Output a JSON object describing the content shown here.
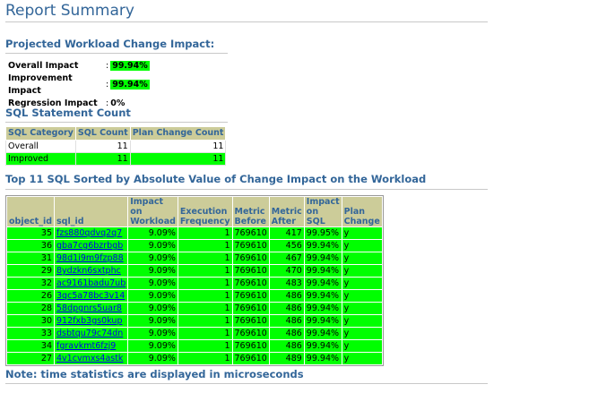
{
  "report": {
    "title": "Report Summary"
  },
  "impact": {
    "heading": "Projected Workload Change Impact:",
    "rows": [
      {
        "label": "Overall Impact",
        "sep": ":",
        "value": "99.94%",
        "highlight": true
      },
      {
        "label": "Improvement Impact",
        "sep": ":",
        "value": "99.94%",
        "highlight": true
      },
      {
        "label": "Regression Impact",
        "sep": ":",
        "value": "0%",
        "highlight": false
      }
    ]
  },
  "count": {
    "heading": "SQL Statement Count",
    "headers": [
      "SQL Category",
      "SQL Count",
      "Plan Change Count"
    ],
    "rows": [
      {
        "category": "Overall",
        "sql_count": "11",
        "plan_change_count": "11",
        "green": false
      },
      {
        "category": "Improved",
        "sql_count": "11",
        "plan_change_count": "11",
        "green": true
      }
    ]
  },
  "top": {
    "heading": "Top 11 SQL Sorted by Absolute Value of Change Impact on the Workload",
    "headers": [
      "object_id",
      "sql_id",
      "Impact on Workload",
      "Execution Frequency",
      "Metric Before",
      "Metric After",
      "Impact on SQL",
      "Plan Change"
    ],
    "rows": [
      [
        "35",
        "fzs880qdvq2q7",
        "9.09%",
        "1",
        "769610",
        "417",
        "99.95%",
        "y"
      ],
      [
        "36",
        "gba7cg6bzrbgb",
        "9.09%",
        "1",
        "769610",
        "456",
        "99.94%",
        "y"
      ],
      [
        "31",
        "98d1i9m9fzp88",
        "9.09%",
        "1",
        "769610",
        "467",
        "99.94%",
        "y"
      ],
      [
        "29",
        "8ydzkn6sxtphc",
        "9.09%",
        "1",
        "769610",
        "470",
        "99.94%",
        "y"
      ],
      [
        "32",
        "ac9161badu7ub",
        "9.09%",
        "1",
        "769610",
        "483",
        "99.94%",
        "y"
      ],
      [
        "26",
        "3qc5a78bc3v14",
        "9.09%",
        "1",
        "769610",
        "486",
        "99.94%",
        "y"
      ],
      [
        "28",
        "58dpgnrs5uar8",
        "9.09%",
        "1",
        "769610",
        "486",
        "99.94%",
        "y"
      ],
      [
        "30",
        "912fxb3gs0kup",
        "9.09%",
        "1",
        "769610",
        "486",
        "99.94%",
        "y"
      ],
      [
        "33",
        "dsbtqu79c74dn",
        "9.09%",
        "1",
        "769610",
        "486",
        "99.94%",
        "y"
      ],
      [
        "34",
        "fgravkmt6fzj9",
        "9.09%",
        "1",
        "769610",
        "486",
        "99.94%",
        "y"
      ],
      [
        "27",
        "4v1cvmxs4astk",
        "9.09%",
        "1",
        "769610",
        "489",
        "99.94%",
        "y"
      ]
    ]
  },
  "note": "Note: time statistics are displayed in microseconds",
  "colors": {
    "heading": "#336699",
    "header_bg": "#cccc99",
    "highlight": "#00ff00",
    "link": "#0000ee"
  }
}
